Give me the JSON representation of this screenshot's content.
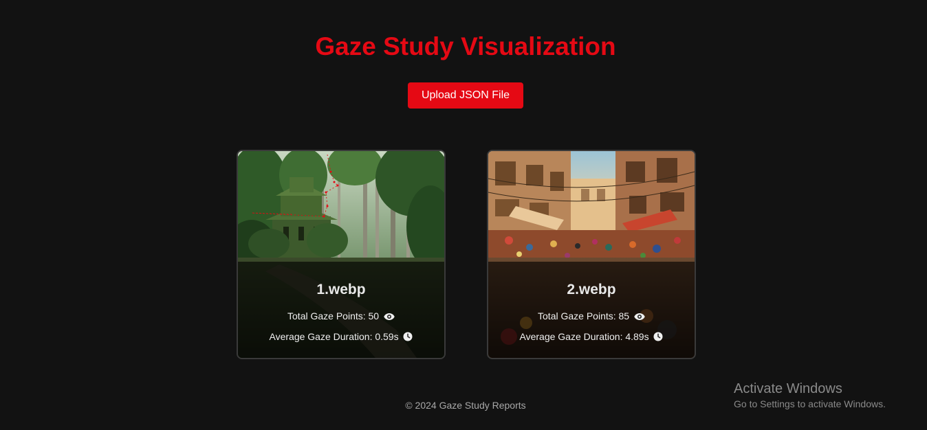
{
  "header": {
    "title": "Gaze Study Visualization",
    "title_color": "#e50914"
  },
  "upload": {
    "label": "Upload JSON File"
  },
  "cards": [
    {
      "name": "1.webp",
      "points_label": "Total Gaze Points: 50",
      "duration_label": "Average Gaze Duration: 0.59s",
      "image_subject": "forest temple with gaze path overlay"
    },
    {
      "name": "2.webp",
      "points_label": "Total Gaze Points: 85",
      "duration_label": "Average Gaze Duration: 4.89s",
      "image_subject": "crowded bazaar street"
    }
  ],
  "icons": {
    "points": "eye-icon",
    "duration": "clock-icon"
  },
  "footer": {
    "text": "© 2024 Gaze Study Reports"
  },
  "watermark": {
    "title": "Activate Windows",
    "subtitle": "Go to Settings to activate Windows."
  }
}
